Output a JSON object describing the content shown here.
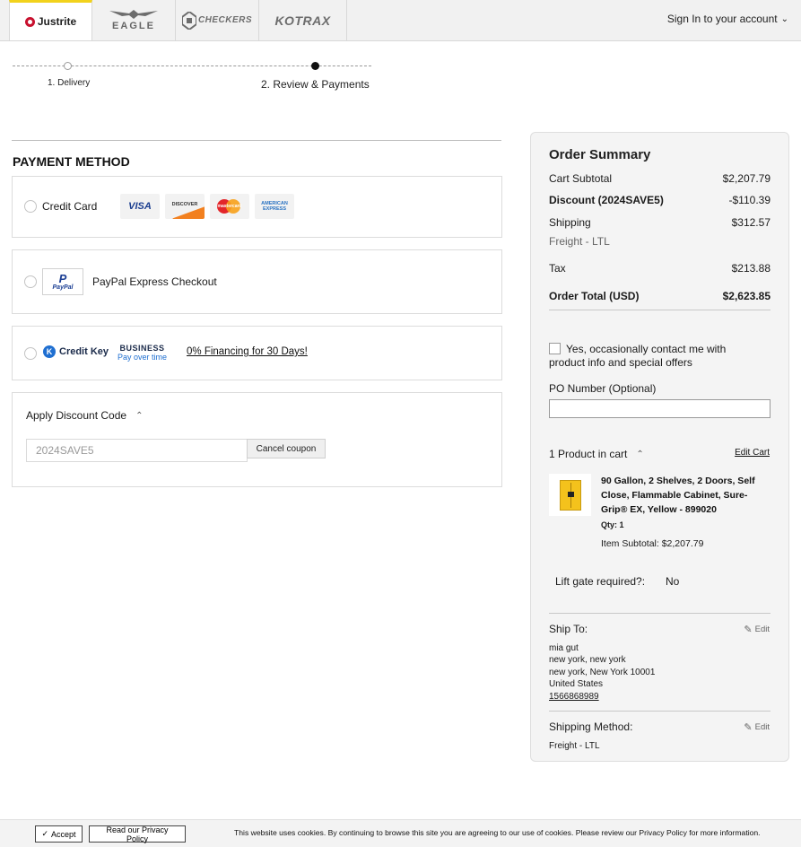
{
  "brands": {
    "justrite": "Justrite",
    "eagle": "EAGLE",
    "checkers": "CHECKERS",
    "kotrax": "KOTRAX"
  },
  "header": {
    "signin_label": "Sign In to your account",
    "signin_icon": "chevron-down-icon"
  },
  "progress": {
    "steps": [
      "1. Delivery",
      "2. Review & Payments"
    ],
    "active_step": 2
  },
  "payment": {
    "title": "PAYMENT METHOD",
    "credit_card_label": "Credit Card",
    "cards": {
      "visa": "VISA",
      "discover": "DISCOVER",
      "mastercard": "mastercard",
      "amex_1": "AMERICAN",
      "amex_2": "EXPRESS"
    },
    "paypal_logo_text": "PayPal",
    "paypal_label": "PayPal Express Checkout",
    "creditkey_logo": "Credit Key",
    "creditkey_badge_1": "BUSINESS",
    "creditkey_badge_2": "Pay over time",
    "creditkey_promo": "0% Financing for 30 Days!"
  },
  "discount": {
    "heading": "Apply Discount Code",
    "code_value": "2024SAVE5",
    "cancel_label": "Cancel coupon"
  },
  "summary": {
    "title": "Order Summary",
    "cart_subtotal_label": "Cart Subtotal",
    "cart_subtotal": "$2,207.79",
    "discount_label": "Discount (2024SAVE5)",
    "discount": "-$110.39",
    "shipping_label": "Shipping",
    "shipping": "$312.57",
    "shipping_method": "Freight - LTL",
    "tax_label": "Tax",
    "tax": "$213.88",
    "total_label": "Order Total (USD)",
    "total": "$2,623.85",
    "optin_label": "Yes, occasionally contact me with product info and special offers",
    "po_label": "PO Number (Optional)",
    "po_value": ""
  },
  "cart": {
    "count_label": "1 Product in cart",
    "edit_label": "Edit Cart",
    "product_name": "90 Gallon, 2 Shelves, 2 Doors, Self Close, Flammable Cabinet, Sure-Grip® EX, Yellow - 899020",
    "qty_label": "Qty: 1",
    "item_subtotal": "Item Subtotal: $2,207.79",
    "lift_gate_label": "Lift gate required?:",
    "lift_gate_value": "No"
  },
  "ship_to": {
    "heading": "Ship To:",
    "edit_label": "Edit",
    "name": "mia gut",
    "line1": "new york, new york",
    "line2": "new york, New York 10001",
    "country": "United States",
    "phone": "1566868989"
  },
  "shipping_method": {
    "heading": "Shipping Method:",
    "edit_label": "Edit",
    "value": "Freight - LTL"
  },
  "cookie": {
    "accept_label": "Accept",
    "privacy_label": "Read our Privacy Policy",
    "message": "This website uses cookies. By continuing to browse this site you are agreeing to our use of cookies. Please review our Privacy Policy for more information."
  }
}
